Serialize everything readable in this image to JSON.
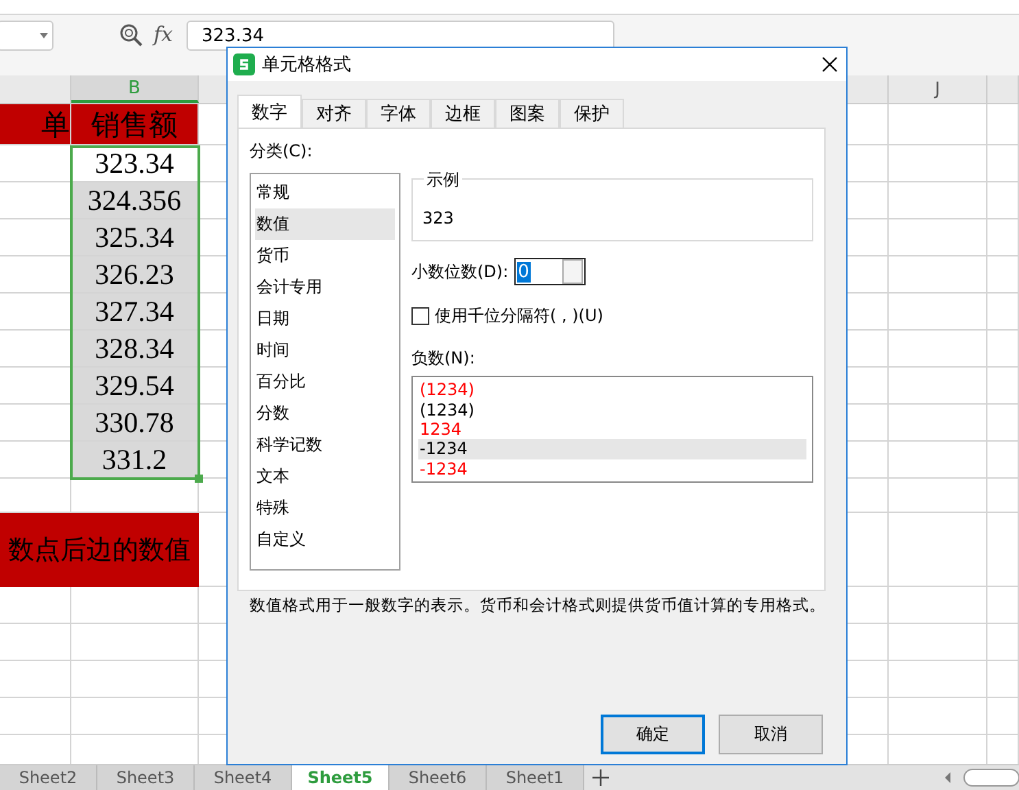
{
  "formula_bar": {
    "fx_label": "fx",
    "formula": "323.34"
  },
  "column_headers": [
    {
      "label": "B",
      "selected": true
    },
    {
      "label": "J",
      "selected": false
    }
  ],
  "header_row": [
    "单",
    "销售额"
  ],
  "values": [
    "323.34",
    "324.356",
    "325.34",
    "326.23",
    "327.34",
    "328.34",
    "329.54",
    "330.78",
    "331.2"
  ],
  "banner": "数点后边的数值",
  "dialog": {
    "title": "单元格格式",
    "tabs": [
      {
        "label": "数字",
        "selected": true
      },
      {
        "label": "对齐",
        "selected": false
      },
      {
        "label": "字体",
        "selected": false
      },
      {
        "label": "边框",
        "selected": false
      },
      {
        "label": "图案",
        "selected": false
      },
      {
        "label": "保护",
        "selected": false
      }
    ],
    "category_label": "分类(C):",
    "categories": [
      {
        "label": "常规",
        "selected": false
      },
      {
        "label": "数值",
        "selected": true
      },
      {
        "label": "货币",
        "selected": false
      },
      {
        "label": "会计专用",
        "selected": false
      },
      {
        "label": "日期",
        "selected": false
      },
      {
        "label": "时间",
        "selected": false
      },
      {
        "label": "百分比",
        "selected": false
      },
      {
        "label": "分数",
        "selected": false
      },
      {
        "label": "科学记数",
        "selected": false
      },
      {
        "label": "文本",
        "selected": false
      },
      {
        "label": "特殊",
        "selected": false
      },
      {
        "label": "自定义",
        "selected": false
      }
    ],
    "sample_label": "示例",
    "sample_value": "323",
    "decimals_label": "小数位数(D):",
    "decimals_value": "0",
    "thousands": {
      "label": "使用千位分隔符( , )(U)",
      "checked": false
    },
    "negative_label": "负数(N):",
    "negative_formats": [
      {
        "label": "(1234)",
        "color": "#ff0000",
        "selected": false
      },
      {
        "label": "(1234)",
        "color": "#000000",
        "selected": false
      },
      {
        "label": "1234",
        "color": "#ff0000",
        "selected": false
      },
      {
        "label": "-1234",
        "color": "#000000",
        "selected": true
      },
      {
        "label": "-1234",
        "color": "#ff0000",
        "selected": false
      }
    ],
    "description": "数值格式用于一般数字的表示。货币和会计格式则提供货币值计算的专用格式。",
    "buttons": [
      {
        "label": "确定",
        "kind": "primary"
      },
      {
        "label": "取消",
        "kind": "secondary"
      }
    ]
  },
  "sheet_tabs": [
    {
      "label": "Sheet2",
      "selected": false
    },
    {
      "label": "Sheet3",
      "selected": false
    },
    {
      "label": "Sheet4",
      "selected": false
    },
    {
      "label": "Sheet5",
      "selected": true
    },
    {
      "label": "Sheet6",
      "selected": false
    },
    {
      "label": "Sheet1",
      "selected": false
    }
  ]
}
